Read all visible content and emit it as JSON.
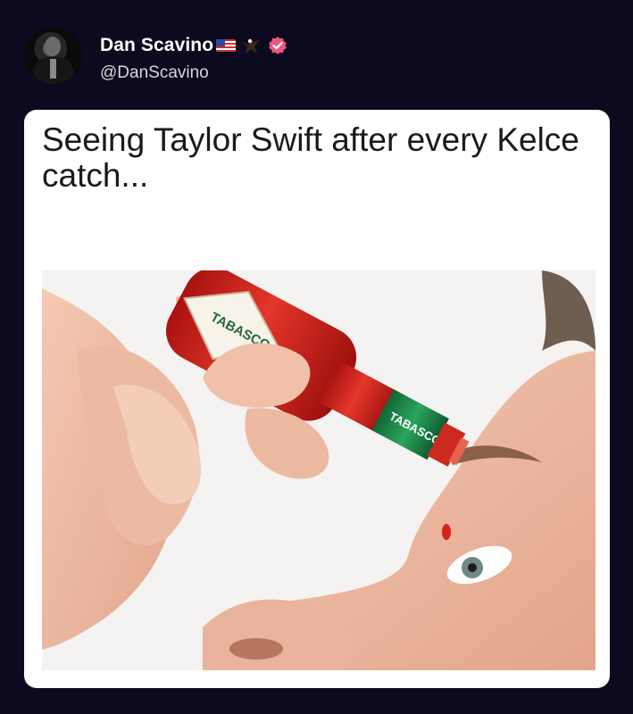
{
  "post": {
    "author_name": "Dan Scavino",
    "handle": "@DanScavino",
    "author_badges": [
      "us-flag-icon",
      "eagle-icon",
      "verified-badge-icon"
    ],
    "verified_color": "#f0567c"
  },
  "meme": {
    "caption": "Seeing Taylor Swift after every Kelce catch...",
    "image_description_icon": "tabasco-eyedrop-photo",
    "bottle_label_text": "TABASCO",
    "bottle_neck_text": "TABASCO"
  },
  "colors": {
    "background": "#0b0a1f",
    "card": "#ffffff",
    "bottle_red": "#d8231c",
    "bottle_green": "#1f8a4c"
  }
}
